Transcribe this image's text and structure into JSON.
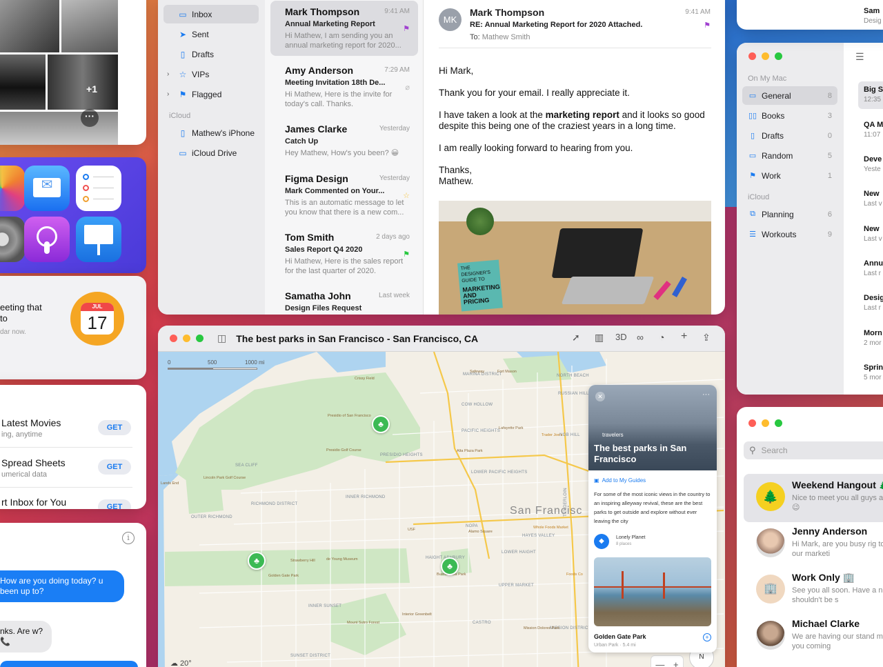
{
  "photos": {
    "more_count": "+1",
    "more_icon": "ellipsis-icon"
  },
  "calendar": {
    "month": "JUL",
    "day": "17",
    "snippet_line1": "eeting that",
    "snippet_line2": "to",
    "snippet_line3": "dar now."
  },
  "app_store": {
    "rows": [
      {
        "title": "Latest Movies",
        "subtitle": "ing, anytime",
        "button": "GET"
      },
      {
        "title": "Spread Sheets",
        "subtitle": "umerical data",
        "button": "GET"
      },
      {
        "title": "rt Inbox for You",
        "subtitle": "",
        "button": "GET"
      }
    ]
  },
  "messages_left": {
    "bubble_out": "How are you doing today? u been up to?",
    "bubble_in": "nks. Are w? 📞"
  },
  "mail": {
    "sidebar": [
      {
        "label": "Inbox",
        "icon": "tray-icon"
      },
      {
        "label": "Sent",
        "icon": "paperplane-icon"
      },
      {
        "label": "Drafts",
        "icon": "doc-icon"
      },
      {
        "label": "VIPs",
        "icon": "star-icon"
      },
      {
        "label": "Flagged",
        "icon": "flag-icon"
      }
    ],
    "icloud_header": "iCloud",
    "icloud_items": [
      {
        "label": "Mathew's iPhone",
        "icon": "iphone-icon"
      },
      {
        "label": "iCloud Drive",
        "icon": "tray-icon"
      }
    ],
    "messages": [
      {
        "name": "Mark Thompson",
        "time": "9:41 AM",
        "subject": "Annual Marketing Report",
        "preview": "Hi Mathew, I am sending you an annual marketing report for 2020..."
      },
      {
        "name": "Amy Anderson",
        "time": "7:29 AM",
        "subject": "Meeting Invitation 18th De...",
        "preview": "Hi Mathew, Here is the invite for today's call. Thanks."
      },
      {
        "name": "James Clarke",
        "time": "Yesterday",
        "subject": "Catch Up",
        "preview": "Hey Mathew, How's you been? 😀"
      },
      {
        "name": "Figma Design",
        "time": "Yesterday",
        "subject": "Mark Commented on Your...",
        "preview": "This is an automatic message to let you know that there is a new com..."
      },
      {
        "name": "Tom Smith",
        "time": "2 days ago",
        "subject": "Sales Report Q4 2020",
        "preview": "Hi Mathew, Here is the sales report for the last quarter of 2020."
      },
      {
        "name": "Samatha John",
        "time": "Last week",
        "subject": "Design Files Request",
        "preview": ""
      }
    ],
    "reader": {
      "initials": "MK",
      "from": "Mark Thompson",
      "time": "9:41 AM",
      "subject": "RE: Annual Marketing Report for 2020 Attached.",
      "to_label": "To:",
      "to": "Mathew Smith",
      "greeting": "Hi Mark,",
      "p1": "Thank you for your email. I really appreciate it.",
      "p2_a": "I have taken a look at the ",
      "p2_b": "marketing report",
      "p2_c": " and it looks so good despite this being one of the craziest years in a long time.",
      "p3": "I am really looking forward to hearing from you.",
      "sign1": "Thanks,",
      "sign2": "Mathew.",
      "book1": "THE DESIGNER'S GUIDE TO",
      "book2": "MARKETING AND PRICING"
    }
  },
  "maps": {
    "title": "The best parks in San Francisco - San Francisco, CA",
    "toolbar_3d": "3D",
    "scale_0": "0",
    "scale_500": "500",
    "scale_1000": "1000 mi",
    "city_label": "San Francisc",
    "temperature": "☁ 20°",
    "compass": "N",
    "zoom_minus": "—",
    "zoom_plus": "+",
    "neighborhoods": [
      "MARINA DISTRICT",
      "COW HOLLOW",
      "RUSSIAN HILL",
      "NORTH BEACH",
      "PACIFIC HEIGHTS",
      "NOB HILL",
      "PRESIDIO HEIGHTS",
      "SEA CLIFF",
      "LOWER PACIFIC HEIGHTS",
      "INNER RICHMOND",
      "RICHMOND DISTRICT",
      "OUTER RICHMOND",
      "HAYES VALLEY",
      "NOPA",
      "LOWER HAIGHT",
      "HAIGHT ASHBURY",
      "INNER SUNSET",
      "CASTRO",
      "MISSION DISTRICT",
      "SUNSET DISTRICT",
      "UPPER MARKET",
      "TENDERLOIN"
    ],
    "places": [
      "Presidio of San Francisco",
      "Crissy Field",
      "Golden Gate Park",
      "Strawberry Hill",
      "Alamo Square",
      "Buena Vista Park",
      "Lafayette Park",
      "Alta Plaza Park",
      "Fort Mason",
      "Safeway",
      "USF",
      "Lincoln Park Golf Course",
      "Presidio Golf Course",
      "Lands End",
      "Mount Sutro Forest",
      "Interior Greenbelt",
      "Mission Dolores Park",
      "de Young Museum",
      "Trader Joe's",
      "Whole Foods Market",
      "Foods Co"
    ],
    "guide": {
      "brand": "travelers",
      "title": "The best parks in San Francisco",
      "add_label": "Add to My Guides",
      "description": "For some of the most iconic views in the country to an inspiring alleyway revival, these are the best parks to get outside and explore without ever leaving the city",
      "author": "Lonely Planet",
      "author_count": "8 places",
      "place_name": "Golden Gate Park",
      "place_meta": "Urban Park · 5.4 mi"
    }
  },
  "notes": {
    "header_mac": "On My Mac",
    "folders": [
      {
        "label": "General",
        "count": "8",
        "icon": "folder-icon"
      },
      {
        "label": "Books",
        "count": "3",
        "icon": "book-icon"
      },
      {
        "label": "Drafts",
        "count": "0",
        "icon": "doc-icon"
      },
      {
        "label": "Random",
        "count": "5",
        "icon": "tray-icon"
      },
      {
        "label": "Work",
        "count": "1",
        "icon": "flag-icon"
      }
    ],
    "header_icloud": "iCloud",
    "icloud_folders": [
      {
        "label": "Planning",
        "count": "6",
        "icon": "copy-icon"
      },
      {
        "label": "Workouts",
        "count": "9",
        "icon": "list-icon"
      }
    ],
    "top_rows": [
      {
        "a": "Sam",
        "b": "Desig"
      }
    ],
    "rows": [
      {
        "a": "Big S",
        "b": "12:35"
      },
      {
        "a": "QA M",
        "b": "11:07"
      },
      {
        "a": "Deve",
        "b": "Yeste"
      },
      {
        "a": "New",
        "b": "Last v"
      },
      {
        "a": "New",
        "b": "Last v"
      },
      {
        "a": "Annu",
        "b": "Last r"
      },
      {
        "a": "Desig",
        "b": "Last r"
      },
      {
        "a": "Morn",
        "b": "2 mor"
      },
      {
        "a": "Sprin",
        "b": "5 mor"
      }
    ]
  },
  "messages_right": {
    "search_placeholder": "Search",
    "conversations": [
      {
        "name": "Weekend Hangout 🌲",
        "preview": "Nice to meet you all guys a group call? 😉"
      },
      {
        "name": "Jenny Anderson",
        "preview": "Hi Mark, are you busy rig to you about our marketi"
      },
      {
        "name": "Work Only 🏢",
        "preview": "See you all soon. Have a next week shouldn't be s"
      },
      {
        "name": "Michael Clarke",
        "preview": "We are having our stand morning, are you coming"
      }
    ]
  }
}
